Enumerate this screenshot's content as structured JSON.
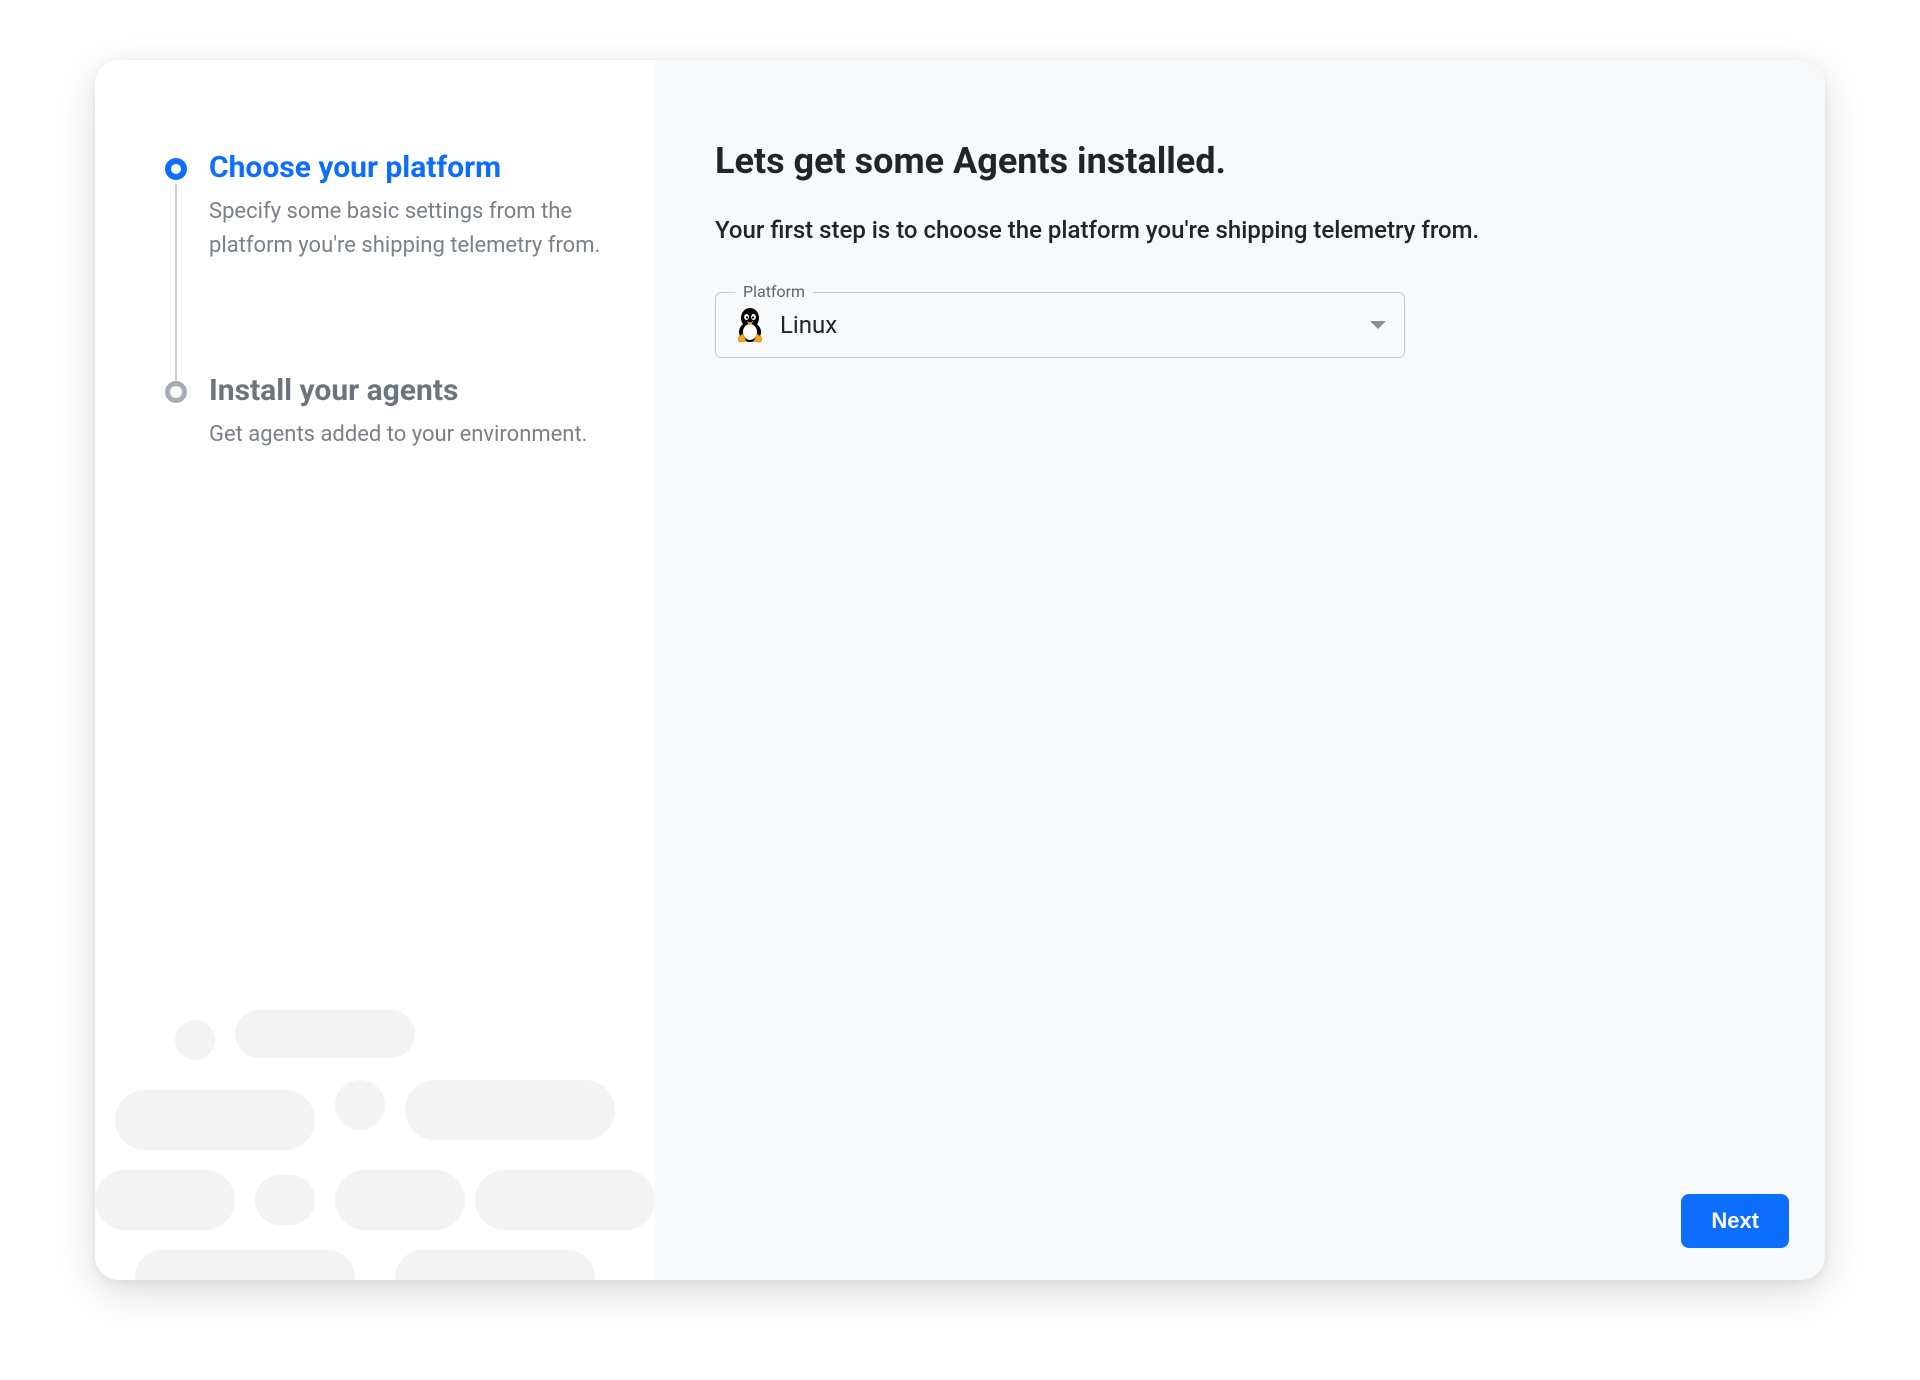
{
  "wizard": {
    "steps": [
      {
        "title": "Choose your platform",
        "description": "Specify some basic settings from the platform you're shipping telemetry from.",
        "active": true
      },
      {
        "title": "Install your agents",
        "description": "Get agents added to your environment.",
        "active": false
      }
    ]
  },
  "main": {
    "heading": "Lets get some Agents installed.",
    "subheading": "Your first step is to choose the platform you're shipping telemetry from.",
    "platform_select": {
      "label": "Platform",
      "selected": "Linux",
      "icon": "linux-icon"
    }
  },
  "actions": {
    "next_label": "Next"
  },
  "colors": {
    "primary": "#0d6efd",
    "muted": "#6c757d",
    "panel_bg": "#f8f9fa",
    "border": "#c6cad0"
  }
}
